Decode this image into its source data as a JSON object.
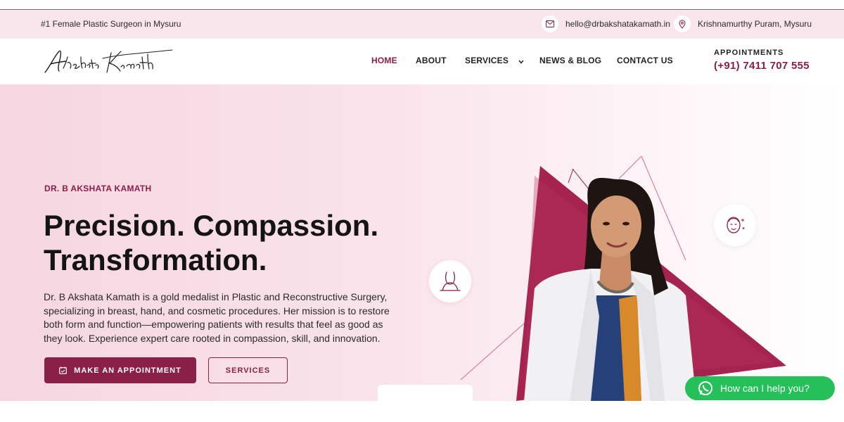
{
  "topbar": {
    "tagline": "#1 Female Plastic Surgeon in Mysuru",
    "email": "hello@drbakshatakamath.in",
    "address": "Krishnamurthy Puram, Mysuru",
    "email_icon": "mail-icon",
    "address_icon": "location-pin-icon"
  },
  "logo": {
    "text": "Akshata Kamath"
  },
  "nav": {
    "items": [
      {
        "label": "HOME",
        "active": true
      },
      {
        "label": "ABOUT"
      },
      {
        "label": "SERVICES",
        "has_dropdown": true
      },
      {
        "label": "NEWS & BLOG"
      },
      {
        "label": "CONTACT US"
      }
    ]
  },
  "appointments": {
    "label": "APPOINTMENTS",
    "phone": "(+91) 7411 707 555"
  },
  "hero": {
    "eyebrow": "DR. B AKSHATA KAMATH",
    "headline_line1": "Precision. Compassion.",
    "headline_line2": "Transformation.",
    "description": "Dr. B Akshata Kamath is a gold medalist in Plastic and Reconstructive Surgery, specializing in breast, hand, and cosmetic procedures. Her mission is to restore both form and function—empowering patients with results that feel as good as they look. Experience expert care rooted in compassion, skill, and innovation.",
    "primary_button": "MAKE AN APPOINTMENT",
    "secondary_button": "SERVICES"
  },
  "whatsapp": {
    "label": "How can I help you?",
    "icon": "whatsapp-icon"
  },
  "colors": {
    "brand": "#8a1f47",
    "topbar_bg": "#f8e6ec",
    "hero_pink": "#f6d6e1",
    "whatsapp": "#25c05a"
  }
}
